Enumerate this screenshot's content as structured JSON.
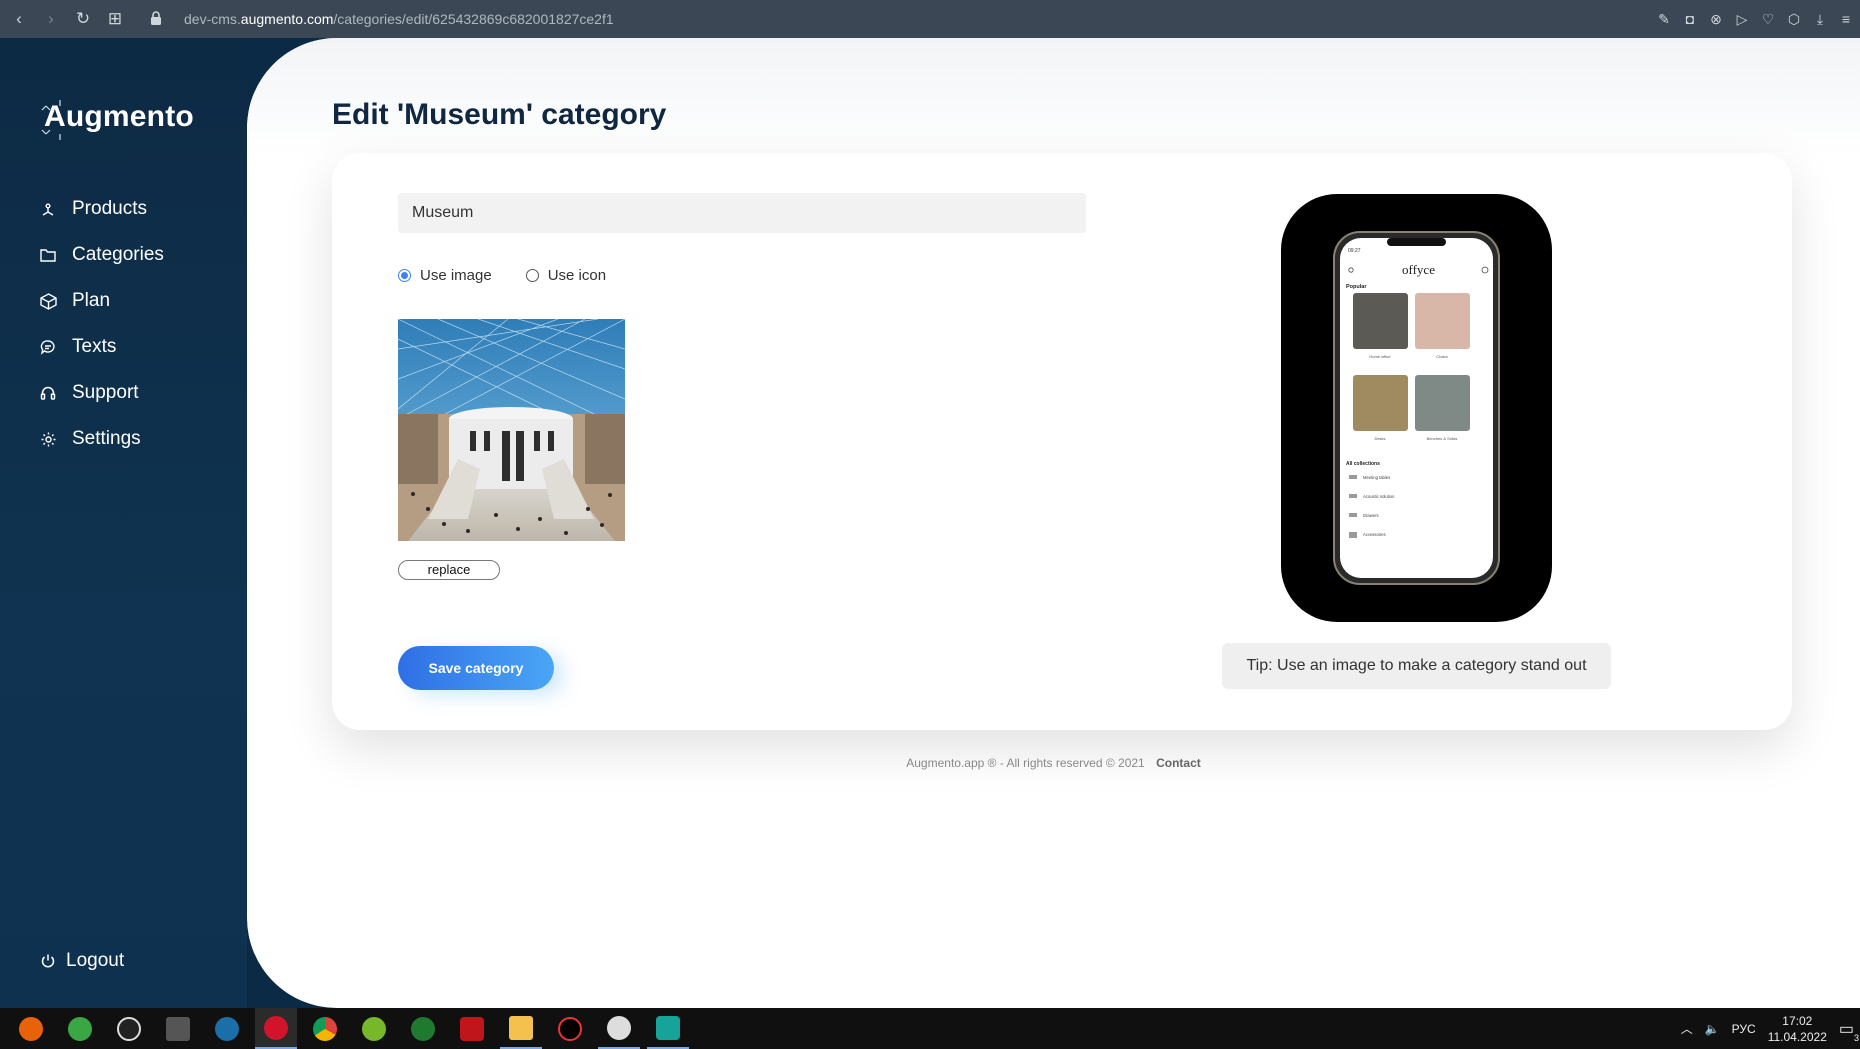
{
  "browser": {
    "url_prefix": "dev-cms.",
    "url_domain": "augmento.com",
    "url_path": "/categories/edit/625432869c682001827ce2f1"
  },
  "sidebar": {
    "logo": "Augmento",
    "items": [
      {
        "label": "Products",
        "icon": "products-icon"
      },
      {
        "label": "Categories",
        "icon": "folder-icon"
      },
      {
        "label": "Plan",
        "icon": "box-icon"
      },
      {
        "label": "Texts",
        "icon": "chat-icon"
      },
      {
        "label": "Support",
        "icon": "headset-icon"
      },
      {
        "label": "Settings",
        "icon": "gear-icon"
      }
    ],
    "logout": "Logout"
  },
  "main": {
    "title": "Edit 'Museum' category",
    "name_value": "Museum",
    "radio_image": "Use image",
    "radio_icon": "Use icon",
    "selected": "image",
    "replace_label": "replace",
    "save_label": "Save category",
    "tip": "Tip: Use an image to make a category stand out"
  },
  "phone": {
    "time": "09:27",
    "brand": "offyce",
    "popular": "Popular",
    "tiles": [
      "Home office",
      "Chairs",
      "Desks",
      "Benches & Sofas"
    ],
    "all_collections": "All collections",
    "collections": [
      "Meeting tables",
      "Acoustic solution",
      "Drawers",
      "Accessories"
    ]
  },
  "footer": {
    "text": "Augmento.app ® - All rights reserved © 2021",
    "contact": "Contact"
  },
  "taskbar": {
    "lang": "РУС",
    "time": "17:02",
    "date": "11.04.2022",
    "notif_count": "3"
  },
  "colors": {
    "accent": "#3b82f6",
    "sidebar": "#0d2a44"
  }
}
